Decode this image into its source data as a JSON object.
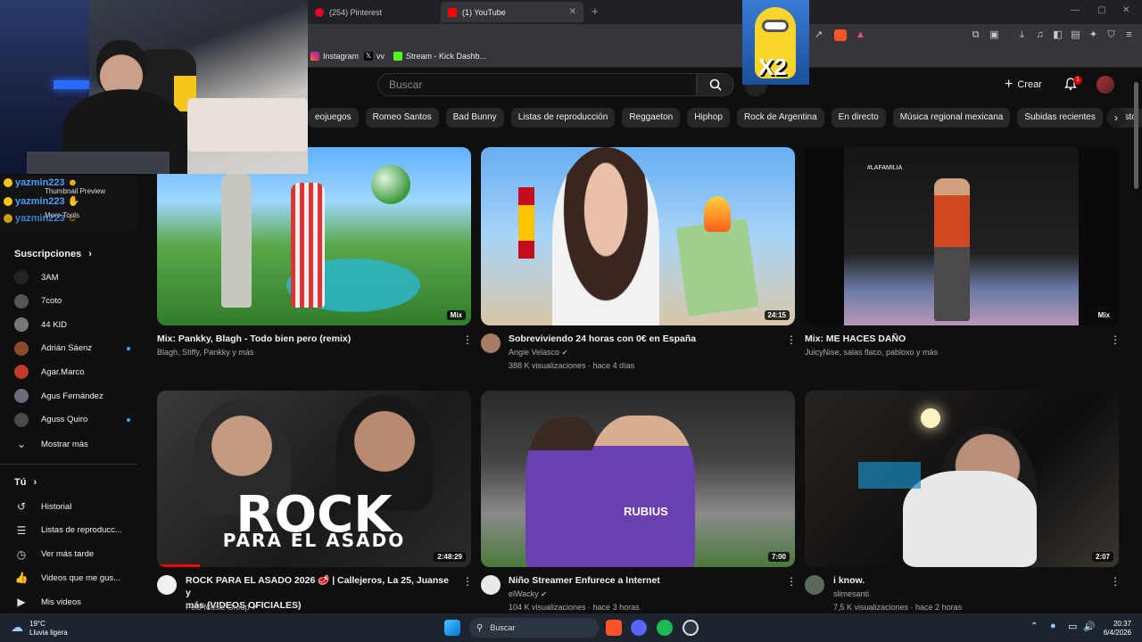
{
  "browser": {
    "tabs": [
      {
        "label": "(254) Pinterest",
        "color": "#e60023"
      },
      {
        "label": "(1) YouTube",
        "color": "#ff0000"
      }
    ],
    "bookmarks": [
      {
        "label": "Instagram",
        "icon": "instagram-icon"
      },
      {
        "label": "vv",
        "icon": "x-icon"
      },
      {
        "label": "Stream - Kick Dashb...",
        "icon": "kick-icon"
      }
    ]
  },
  "header": {
    "search_placeholder": "Buscar",
    "create_label": "Crear",
    "notification_count": "1"
  },
  "chips": [
    "eojuegos",
    "Romeo Santos",
    "Bad Bunny",
    "Listas de reproducción",
    "Reggaeton",
    "Hiphop",
    "Rock de Argentina",
    "En directo",
    "Música regional mexicana",
    "Subidas recientes",
    "Visto"
  ],
  "sidebar": {
    "subscriptions_title": "Suscripciones",
    "subscriptions": [
      {
        "label": "3AM",
        "color": "#222",
        "dot": false
      },
      {
        "label": "7coto",
        "color": "#555",
        "dot": false
      },
      {
        "label": "44 KID",
        "color": "#777",
        "dot": false
      },
      {
        "label": "Adrián Sáenz",
        "color": "#8a4b2b",
        "dot": true
      },
      {
        "label": "Agar.Marco",
        "color": "#c0392b",
        "dot": false
      },
      {
        "label": "Agus Fernández",
        "color": "#6b6b7a",
        "dot": false
      },
      {
        "label": "Aguss Quiro",
        "color": "#4a4a4a",
        "dot": true
      }
    ],
    "show_more": "Mostrar más",
    "you_title": "Tú",
    "you_items": [
      {
        "label": "Historial",
        "icon": "history-icon"
      },
      {
        "label": "Listas de reproducc...",
        "icon": "playlists-icon"
      },
      {
        "label": "Ver más tarde",
        "icon": "watch-later-icon"
      },
      {
        "label": "Videos que me gus...",
        "icon": "liked-icon"
      },
      {
        "label": "Mis videos",
        "icon": "my-videos-icon"
      }
    ]
  },
  "videos": [
    {
      "title": "Mix: Pankky, Blagh - Todo bien pero (remix)",
      "channel": "Blagh, Stiffy, Pankky y más",
      "meta": "",
      "badge": "Mix"
    },
    {
      "title": "Sobreviviendo 24 horas con 0€ en España",
      "channel": "Angie Velasco",
      "meta": "388 K visualizaciones · hace 4 días",
      "badge": "24:15"
    },
    {
      "title": "Mix: ME HACES DAÑO",
      "channel": "JuicyNise, salas flaco, pabloxo y más",
      "meta": "",
      "badge": "Mix"
    },
    {
      "title": "ROCK PARA EL ASADO 2026 🥩 | Callejeros, La 25, Juanse y",
      "title2": "más (VIDEOS OFICIALES)",
      "channel": "Pelo Music Group",
      "meta": "",
      "badge": "2:48:29"
    },
    {
      "title": "Niño Streamer Enfurece a Internet",
      "channel": "elWacky",
      "meta": "104 K visualizaciones · hace 3 horas",
      "badge": "7:00"
    },
    {
      "title": "i know.",
      "channel": "slimesanti",
      "meta": "7,5 K visualizaciones · hace 2 horas",
      "badge": "2:07"
    }
  ],
  "thumb_texts": {
    "rock": "ROCK",
    "asado": "PARA EL ASADO",
    "rubius": "RUBIUS",
    "familia": "#LAFAMILIA"
  },
  "stream": {
    "chat": [
      {
        "user": "yazmin223"
      },
      {
        "user": "yazmin223"
      },
      {
        "user": "yazmin223"
      }
    ],
    "tooltip1": "Thumbnail Preview",
    "tooltip2": "More Tools",
    "emote_text": "X2"
  },
  "taskbar": {
    "weather_temp": "19°C",
    "weather_desc": "Lluvia ligera",
    "search_label": "Buscar",
    "time": "20:37",
    "date": "6/4/2026"
  }
}
